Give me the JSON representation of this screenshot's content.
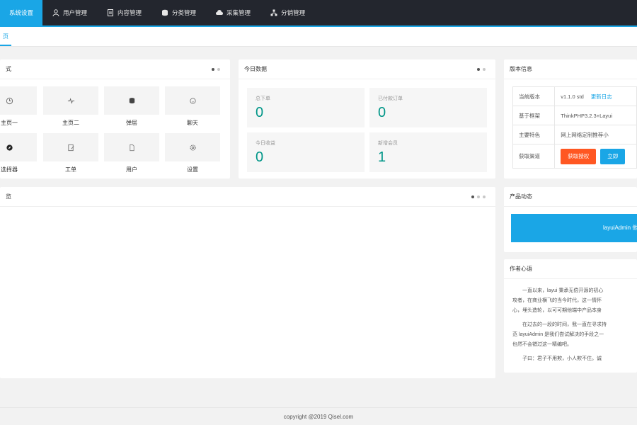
{
  "nav": {
    "items": [
      {
        "label": "系统设置",
        "icon": "none",
        "active": true
      },
      {
        "label": "用户管理",
        "icon": "user-icon"
      },
      {
        "label": "内容管理",
        "icon": "document-icon"
      },
      {
        "label": "分类管理",
        "icon": "database-icon"
      },
      {
        "label": "采集管理",
        "icon": "cloud-icon"
      },
      {
        "label": "分销管理",
        "icon": "org-icon"
      }
    ],
    "accent_color": "#1aa6e6"
  },
  "tab": {
    "label": "页"
  },
  "quick": {
    "title": "式",
    "items": [
      {
        "label": "主页一",
        "icon": "clock-icon"
      },
      {
        "label": "主页二",
        "icon": "pulse-icon"
      },
      {
        "label": "弹层",
        "icon": "layers-icon"
      },
      {
        "label": "聊天",
        "icon": "chat-icon"
      },
      {
        "label": "选择器",
        "icon": "compass-icon"
      },
      {
        "label": "工单",
        "icon": "edit-icon"
      },
      {
        "label": "用户",
        "icon": "file-icon"
      },
      {
        "label": "设置",
        "icon": "gear-icon"
      }
    ]
  },
  "today": {
    "title": "今日数据",
    "stats": [
      {
        "label": "总下单",
        "value": "0"
      },
      {
        "label": "已付款订单",
        "value": "0"
      },
      {
        "label": "今日收益",
        "value": "0"
      },
      {
        "label": "新增会员",
        "value": "1"
      }
    ]
  },
  "version": {
    "title": "版本信息",
    "rows": [
      {
        "key": "当前版本",
        "value": "v1.1.0 std",
        "link": "更新日志"
      },
      {
        "key": "基于框架",
        "value": "ThinkPHP3.2.3+Layui"
      },
      {
        "key": "主要特色",
        "value": "网上网络定制推荐小"
      },
      {
        "key": "获取渠道",
        "buttons": [
          "获取授权",
          "立即"
        ]
      }
    ]
  },
  "overview": {
    "title": "览"
  },
  "product": {
    "title": "产品动态",
    "banner": "layuiAdmin 他"
  },
  "notes": {
    "title": "作者心语",
    "paragraphs": [
      "一直以来，layui 秉承无偿开源的初心",
      "攻者，在商业横飞的当今时代，这一情怀",
      "心，埋头造轮，以可可期他端中产品本身",
      "在过去的一段的时间，我一直在寻求持",
      "范 layuiAdmin 是我们尝试解决的手段之一",
      "也然不会错过这一精编吧。",
      "子曰：君子不用欺，小人欺不住。诚"
    ]
  },
  "footer": {
    "text": "copyright @2019 Qisel.com"
  }
}
